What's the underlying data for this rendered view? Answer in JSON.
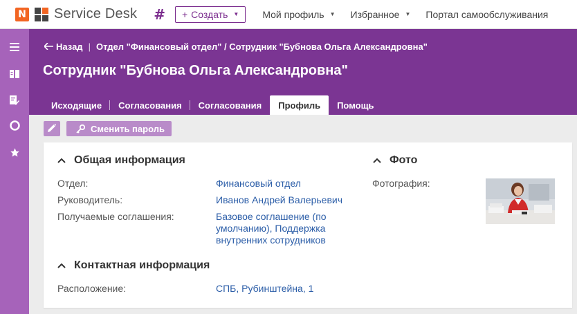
{
  "topbar": {
    "logo_letter": "N",
    "app_name": "Service Desk",
    "hash_symbol": "#",
    "create_label": "Создать",
    "nav": [
      {
        "label": "Мой профиль"
      },
      {
        "label": "Избранное"
      },
      {
        "label": "Портал самообслуживания"
      }
    ]
  },
  "header": {
    "back_label": "Назад",
    "breadcrumb_path": "Отдел \"Финансовый отдел\" / Сотрудник \"Бубнова Ольга Александровна\"",
    "title": "Сотрудник \"Бубнова Ольга Александровна\"",
    "tabs": [
      {
        "label": "Исходящие"
      },
      {
        "label": "Согласования"
      },
      {
        "label": "Согласования"
      },
      {
        "label": "Профиль",
        "active": true
      },
      {
        "label": "Помощь"
      }
    ]
  },
  "actions": {
    "change_password_label": "Сменить пароль"
  },
  "general": {
    "title": "Общая информация",
    "department_label": "Отдел:",
    "department_value": "Финансовый отдел",
    "manager_label": "Руководитель:",
    "manager_value": "Иванов Андрей Валерьевич",
    "agreements_label": "Получаемые соглашения:",
    "agreements_line1": "Базовое соглашение (по",
    "agreements_line2": "умолчанию), Поддержка",
    "agreements_line3": "внутренних сотрудников"
  },
  "contact": {
    "title": "Контактная информация",
    "location_label": "Расположение:",
    "location_value": "СПБ, Рубинштейна, 1"
  },
  "photo_section": {
    "title": "Фото",
    "photo_label": "Фотография:"
  },
  "colors": {
    "brand_orange": "#f26522",
    "header_purple": "#7b3593",
    "sidebar_purple": "#a663ba",
    "button_purple": "#b98bc9",
    "link_blue": "#2c5ea8"
  }
}
